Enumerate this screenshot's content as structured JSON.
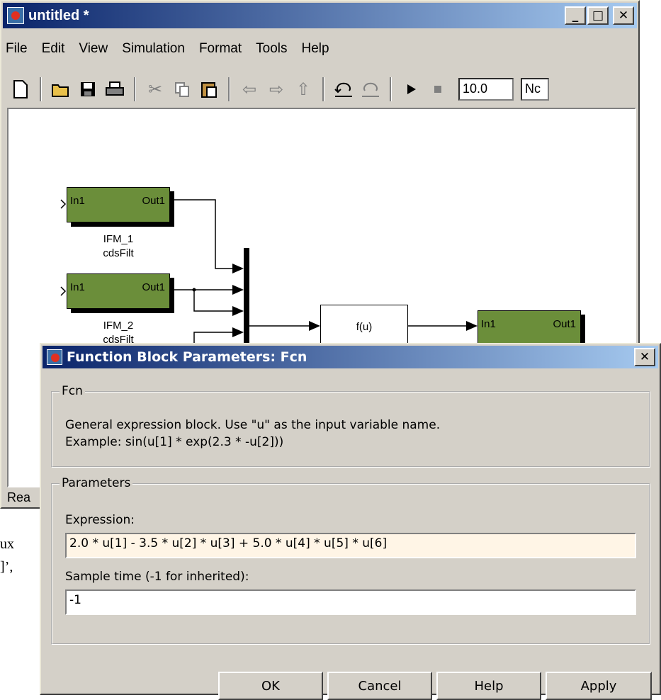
{
  "background_text": {
    "line1": "ux",
    "line2": "]’,"
  },
  "main_window": {
    "title": "untitled *",
    "buttons": {
      "minimize": "_",
      "maximize": "□",
      "close": "✕"
    },
    "menu": [
      {
        "label": "File"
      },
      {
        "label": "Edit"
      },
      {
        "label": "View"
      },
      {
        "label": "Simulation"
      },
      {
        "label": "Format"
      },
      {
        "label": "Tools"
      },
      {
        "label": "Help"
      }
    ],
    "toolbar": {
      "icons": [
        "new-icon",
        "open-icon",
        "save-icon",
        "print-icon",
        "cut-icon",
        "copy-icon",
        "paste-icon",
        "back-icon",
        "forward-icon",
        "up-icon",
        "undo-icon",
        "redo-icon",
        "play-icon",
        "stop-icon"
      ],
      "stop_time": "10.0",
      "sim_mode": "Nc"
    },
    "status": "Rea"
  },
  "diagram": {
    "blocks": [
      {
        "name": "IFM_1",
        "sub": "cdsFilt",
        "in": "In1",
        "out": "Out1"
      },
      {
        "name": "IFM_2",
        "sub": "cdsFilt",
        "in": "In1",
        "out": "Out1"
      },
      {
        "in": "In1",
        "out": "Out1"
      }
    ],
    "fcn_label": "f(u)"
  },
  "dialog": {
    "title": "Function Block Parameters: Fcn",
    "close": "✕",
    "fcn_group": {
      "legend": "Fcn",
      "line1": "General expression block. Use \"u\" as the input variable name.",
      "line2": "Example: sin(u[1] * exp(2.3 * -u[2]))"
    },
    "params_group": {
      "legend": "Parameters",
      "expression_label": "Expression:",
      "expression_value": "2.0 * u[1] - 3.5 * u[2] * u[3] + 5.0 * u[4] * u[5] * u[6]",
      "sample_label": "Sample time (-1 for inherited):",
      "sample_value": "-1"
    },
    "buttons": {
      "ok": "OK",
      "cancel": "Cancel",
      "help": "Help",
      "apply": "Apply"
    }
  }
}
